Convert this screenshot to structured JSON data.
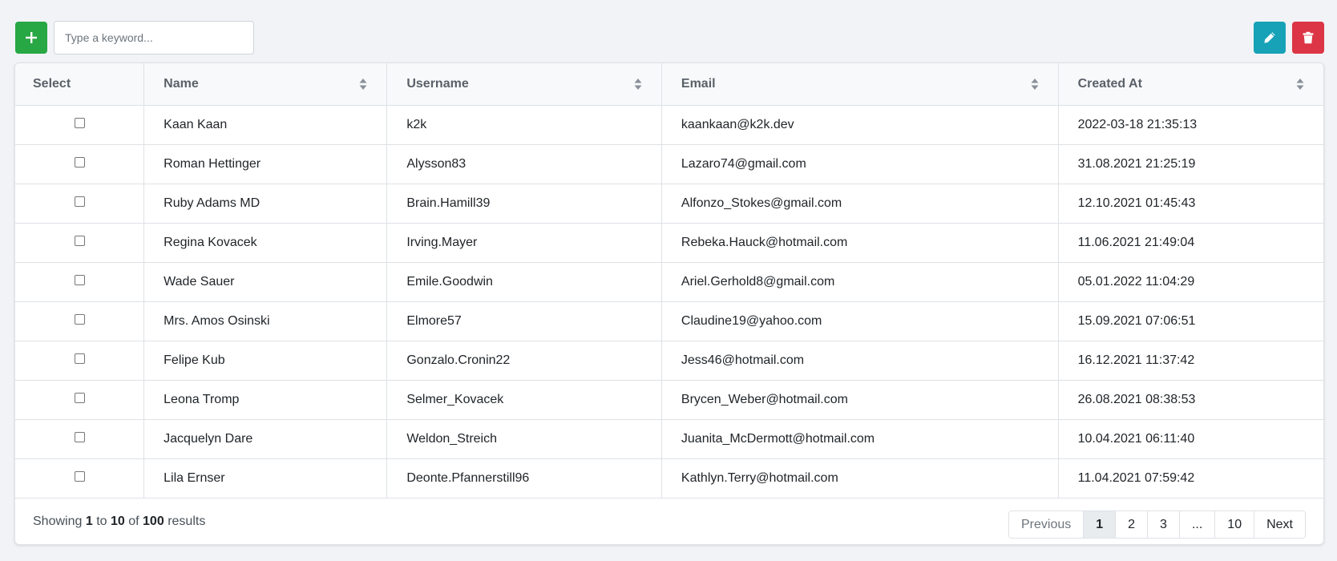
{
  "toolbar": {
    "add_icon": "plus-icon",
    "search_placeholder": "Type a keyword...",
    "search_value": "",
    "edit_icon": "pencil-icon",
    "delete_icon": "trash-icon",
    "colors": {
      "add": "#28a745",
      "edit": "#17a2b8",
      "delete": "#dc3545"
    }
  },
  "table": {
    "headers": {
      "select": "Select",
      "name": "Name",
      "username": "Username",
      "email": "Email",
      "created_at": "Created At"
    },
    "rows": [
      {
        "name": "Kaan Kaan",
        "username": "k2k",
        "email": "kaankaan@k2k.dev",
        "created_at": "2022-03-18 21:35:13"
      },
      {
        "name": "Roman Hettinger",
        "username": "Alysson83",
        "email": "Lazaro74@gmail.com",
        "created_at": "31.08.2021 21:25:19"
      },
      {
        "name": "Ruby Adams MD",
        "username": "Brain.Hamill39",
        "email": "Alfonzo_Stokes@gmail.com",
        "created_at": "12.10.2021 01:45:43"
      },
      {
        "name": "Regina Kovacek",
        "username": "Irving.Mayer",
        "email": "Rebeka.Hauck@hotmail.com",
        "created_at": "11.06.2021 21:49:04"
      },
      {
        "name": "Wade Sauer",
        "username": "Emile.Goodwin",
        "email": "Ariel.Gerhold8@gmail.com",
        "created_at": "05.01.2022 11:04:29"
      },
      {
        "name": "Mrs. Amos Osinski",
        "username": "Elmore57",
        "email": "Claudine19@yahoo.com",
        "created_at": "15.09.2021 07:06:51"
      },
      {
        "name": "Felipe Kub",
        "username": "Gonzalo.Cronin22",
        "email": "Jess46@hotmail.com",
        "created_at": "16.12.2021 11:37:42"
      },
      {
        "name": "Leona Tromp",
        "username": "Selmer_Kovacek",
        "email": "Brycen_Weber@hotmail.com",
        "created_at": "26.08.2021 08:38:53"
      },
      {
        "name": "Jacquelyn Dare",
        "username": "Weldon_Streich",
        "email": "Juanita_McDermott@hotmail.com",
        "created_at": "10.04.2021 06:11:40"
      },
      {
        "name": "Lila Ernser",
        "username": "Deonte.Pfannerstill96",
        "email": "Kathlyn.Terry@hotmail.com",
        "created_at": "11.04.2021 07:59:42"
      }
    ]
  },
  "footer": {
    "summary": {
      "prefix": "Showing",
      "from": "1",
      "to_word": "to",
      "to": "10",
      "of_word": "of",
      "total": "100",
      "suffix": "results"
    },
    "pagination": {
      "previous": "Previous",
      "pages": [
        "1",
        "2",
        "3",
        "...",
        "10"
      ],
      "active_page": "1",
      "next": "Next"
    }
  }
}
